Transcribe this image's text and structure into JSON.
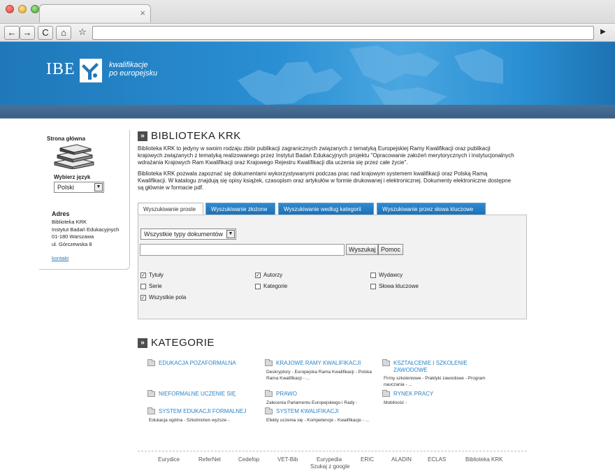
{
  "browser": {
    "tab_close": "×",
    "back": "←",
    "forward": "→",
    "reload": "C",
    "home": "⌂",
    "bookmark": "☆",
    "go": "▶"
  },
  "banner": {
    "logo_text": "IBE",
    "tagline_line1": "kwalifikacje",
    "tagline_line2": "po europejsku"
  },
  "sidebar": {
    "home_title": "Strona główna",
    "lang_label": "Wybierz język",
    "lang_value": "Polski",
    "address_title": "Adres",
    "address_lines": [
      "Biblioteka KRK",
      "Instytut Badań Edukacyjnych",
      "01-180 Warszawa",
      "ul. Górczewska 8"
    ],
    "contact": "kontakt"
  },
  "main": {
    "title": "BIBLIOTEKA KRK",
    "para1": "Biblioteka KRK to jedyny w swoim rodzaju zbiór publikacji zagranicznych związanych z tematyką Europejskiej Ramy Kwalifikacji oraz publikacji krajowych związanych z tematyką realizowanego przez Instytut Badań Edukacyjnych projektu \"Opracowanie założeń merytorycznych i instytucjonalnych wdrażania Krajowych Ram Kwalifikacji oraz Krajowego Rejestru Kwalifikacji dla uczenia się przez całe życie\".",
    "para2": "Biblioteka KRK pozwala zapoznać się dokumentami wykorzystywanymi podczas prac nad krajowym systemem kwalifikacji oraz Polską Ramą Kwalifikacji. W katalogu znajdują się opisy książek, czasopism oraz artykułów w formie drukowanej i elektronicznej. Dokumenty elektroniczne dostępne są głównie w formacie pdf.",
    "tabs": [
      "Wyszukiwanie proste",
      "Wyszukiwanie złożone",
      "Wyszukiwanie według kategorii",
      "Wyszukiwanie przez słowa kluczowe"
    ],
    "doctype_value": "Wszystkie typy dokumentów",
    "search_value": "",
    "search_button": "Wyszukaj",
    "help_button": "Pomoc",
    "checkboxes": [
      {
        "label": "Tytuły",
        "checked": true
      },
      {
        "label": "Autorzy",
        "checked": true
      },
      {
        "label": "Wydawcy",
        "checked": false
      },
      {
        "label": "Serie",
        "checked": false
      },
      {
        "label": "Kategorie",
        "checked": false
      },
      {
        "label": "Słowa kluczowe",
        "checked": false
      },
      {
        "label": "Wszystkie pola",
        "checked": true
      }
    ],
    "categories_title": "KATEGORIE",
    "categories": [
      {
        "label": "EDUKACJA POZAFORMALNA",
        "desc": ""
      },
      {
        "label": "KRAJOWE RAMY KWALIFIKACJI",
        "desc": "Deskryptory - Europejska Rama Kwalifikacji - Polska Rama Kwalifikacji - ..."
      },
      {
        "label": "KSZTAŁCENIE I SZKOLENIE ZAWODOWE",
        "desc": "Firmy szkoleniowe - Praktyki zawodowe - Program nauczania - ..."
      },
      {
        "label": "NIEFORMALNE UCZENIE SIĘ",
        "desc": ""
      },
      {
        "label": "PRAWO",
        "desc": "Zalecenia Parlamentu Europejskiego i Rady -"
      },
      {
        "label": "RYNEK PRACY",
        "desc": "Mobilność -"
      },
      {
        "label": "SYSTEM EDUKACJI FORMALNEJ",
        "desc": "Edukacja ogólna - Szkolnictwo wyższe -"
      },
      {
        "label": "SYSTEM KWALIFIKACJI",
        "desc": "Efekty uczenia się - Kompetencje - Kwalifikacje - ..."
      }
    ]
  },
  "footer": {
    "links": [
      "Eurydice",
      "ReferNet",
      "Cedefop",
      "VET-Bib",
      "Eurypedia",
      "ERIC",
      "ALADIN",
      "ECLAS",
      "Biblioteka KRK"
    ],
    "google": "Szukaj z google"
  },
  "colors": {
    "banner_blue": "#2a8fd3",
    "tab_blue": "#1b6fb4",
    "link_blue": "#2a84c8"
  }
}
